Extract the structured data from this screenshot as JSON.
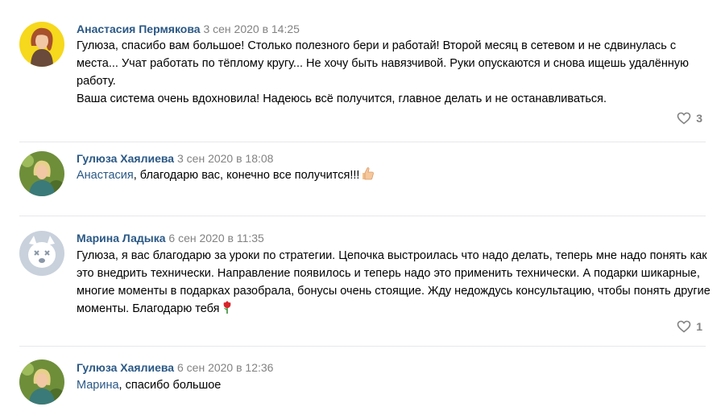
{
  "comments": [
    {
      "author": "Анастасия Пермякова",
      "date": "3 сен 2020 в 14:25",
      "lines": [
        "Гулюза, спасибо вам большое! Столько полезного бери и работай! Второй месяц в сетевом и не сдвинулась с места... Учат работать по тёплому кругу... Не хочу быть навязчивой. Руки опускаются и снова ищешь удалённую работу.",
        "Ваша система очень вдохновила! Надеюсь всё получится, главное делать и не останавливаться."
      ],
      "likes": "3"
    },
    {
      "author": "Гулюза Хаялиева",
      "date": "3 сен 2020 в 18:08",
      "mention": "Анастасия",
      "text": ", благодарю вас, конечно все получится!!!",
      "emoji": "thumbs-up-icon"
    },
    {
      "author": "Марина Ладыка",
      "date": "6 сен 2020 в 11:35",
      "text": "Гулюза, я вас благодарю за уроки по стратегии. Цепочка выстроилась что надо делать, теперь мне надо понять как это внедрить технически. Направление появилось и теперь надо это применить технически. А подарки шикарные, многие моменты в подарках разобрала, бонусы очень стоящие. Жду недождусь консультацию, чтобы понять другие моменты. Благодарю тебя",
      "emoji": "rose-icon",
      "likes": "1"
    },
    {
      "author": "Гулюза Хаялиева",
      "date": "6 сен 2020 в 12:36",
      "mention": "Марина",
      "text": ", спасибо большое"
    }
  ],
  "colors": {
    "author": "#2a5885",
    "date": "#828282",
    "separator": "#e7e8ec"
  }
}
